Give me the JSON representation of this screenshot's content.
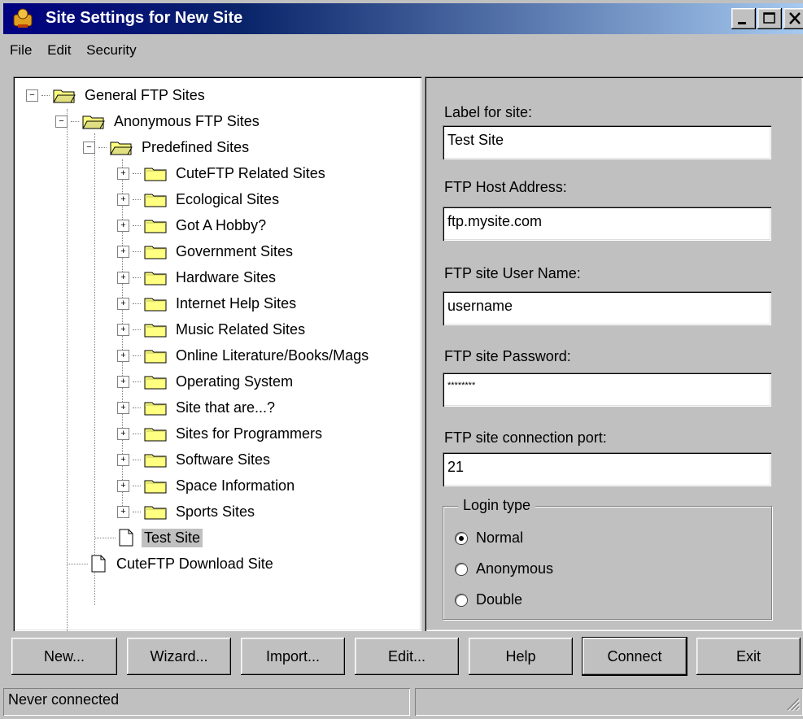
{
  "window": {
    "title": "Site Settings for New Site"
  },
  "menu": {
    "file": "File",
    "edit": "Edit",
    "security": "Security"
  },
  "tree": {
    "root": "General FTP Sites",
    "anonymous": "Anonymous FTP Sites",
    "predefined": "Predefined Sites",
    "categories": [
      "CuteFTP Related Sites",
      "Ecological Sites",
      "Got A Hobby?",
      "Government Sites",
      "Hardware Sites",
      "Internet Help Sites",
      "Music Related Sites",
      "Online Literature/Books/Mags",
      "Operating System",
      "Site that are...?",
      "Sites for Programmers",
      "Software Sites",
      "Space Information",
      "Sports Sites"
    ],
    "test_site": "Test Site",
    "download_site": "CuteFTP Download Site"
  },
  "form": {
    "label_label": "Label for site:",
    "label_value": "Test Site",
    "host_label": "FTP Host Address:",
    "host_value": "ftp.mysite.com",
    "user_label": "FTP site User Name:",
    "user_value": "username",
    "password_label": "FTP site Password:",
    "password_value": "********",
    "port_label": "FTP site connection port:",
    "port_value": "21",
    "login_type_title": "Login type",
    "login_options": [
      "Normal",
      "Anonymous",
      "Double"
    ],
    "login_selected": "Normal"
  },
  "buttons": {
    "new": "New...",
    "wizard": "Wizard...",
    "import": "Import...",
    "edit": "Edit...",
    "help": "Help",
    "connect": "Connect",
    "exit": "Exit"
  },
  "status": {
    "left": "Never connected",
    "right": ""
  },
  "colors": {
    "titlebar_start": "#000080",
    "titlebar_end": "#a6caf0",
    "face": "#c0c0c0",
    "folder": "#ffff80"
  }
}
